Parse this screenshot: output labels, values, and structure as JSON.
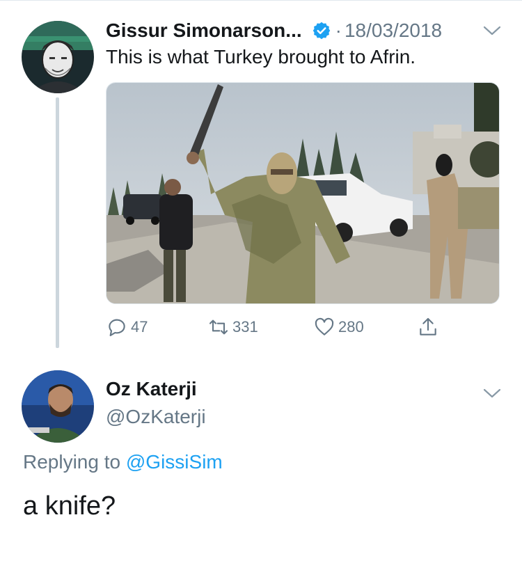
{
  "tweet": {
    "author_name": "Gissur Simonarson...",
    "separator": "·",
    "date": "18/03/2018",
    "text": "This is what Turkey brought to Afrin.",
    "actions": {
      "reply_count": "47",
      "retweet_count": "331",
      "like_count": "280"
    }
  },
  "reply": {
    "author_name": "Oz Katerji",
    "handle": "@OzKaterji",
    "replying_prefix": "Replying to",
    "replying_to": "@GissiSim",
    "text": "a knife?"
  },
  "icons": {
    "verified": "verified-badge-icon",
    "chevron": "chevron-down-icon",
    "reply": "reply-icon",
    "retweet": "retweet-icon",
    "like": "heart-icon",
    "share": "share-icon"
  },
  "colors": {
    "verified_blue": "#1da1f2",
    "secondary_text": "#657786",
    "primary_text": "#14171a",
    "link": "#1da1f2",
    "thread_line": "#ccd6dd"
  }
}
